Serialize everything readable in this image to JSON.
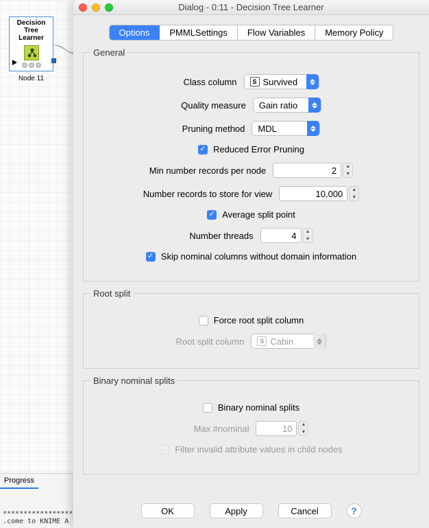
{
  "canvas": {
    "node_title_line1": "Decision",
    "node_title_line2": "Tree Learner",
    "node_label": "Node 11"
  },
  "bottom": {
    "tab": "Progress",
    "console_stars": "**********************************",
    "console_line": ".come to KNIME A"
  },
  "dialog": {
    "title": "Dialog - 0:11 - Decision Tree Learner",
    "tabs": [
      "Options",
      "PMMLSettings",
      "Flow Variables",
      "Memory Policy"
    ],
    "general": {
      "legend": "General",
      "class_column_label": "Class column",
      "class_column_value": "Survived",
      "quality_measure_label": "Quality measure",
      "quality_measure_value": "Gain ratio",
      "pruning_method_label": "Pruning method",
      "pruning_method_value": "MDL",
      "reduced_error_pruning": "Reduced Error Pruning",
      "min_records_label": "Min number records per node",
      "min_records_value": "2",
      "store_view_label": "Number records to store for view",
      "store_view_value": "10,000",
      "avg_split": "Average split point",
      "threads_label": "Number threads",
      "threads_value": "4",
      "skip_nominal": "Skip nominal columns without domain information"
    },
    "root": {
      "legend": "Root split",
      "force_label": "Force root split column",
      "column_label": "Root split column",
      "column_value": "Cabin"
    },
    "binary": {
      "legend": "Binary nominal splits",
      "enable_label": "Binary nominal splits",
      "max_label": "Max #nominal",
      "max_value": "10",
      "filter_label": "Filter invalid attribute values in child nodes"
    },
    "buttons": {
      "ok": "OK",
      "apply": "Apply",
      "cancel": "Cancel"
    }
  }
}
